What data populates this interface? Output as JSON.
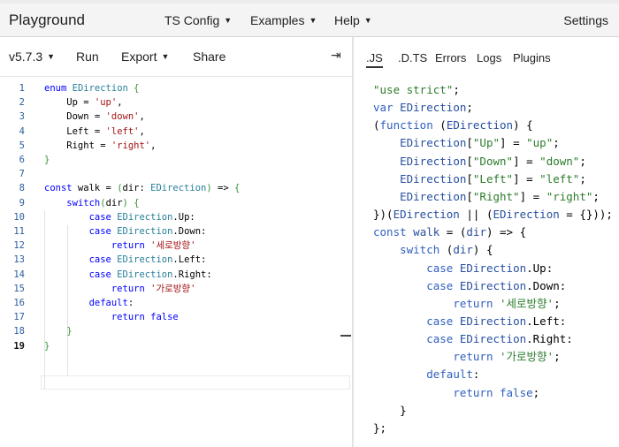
{
  "app": {
    "brand": "Playground",
    "menus": [
      {
        "label": "TS Config"
      },
      {
        "label": "Examples"
      },
      {
        "label": "Help"
      }
    ],
    "settings_label": "Settings"
  },
  "toolbar": {
    "version": "v5.7.3",
    "run": "Run",
    "export": "Export",
    "share": "Share",
    "collapse_icon": "arrow-right-to-bar-icon"
  },
  "output_tabs": [
    ".JS",
    ".D.TS",
    "Errors",
    "Logs",
    "Plugins"
  ],
  "output_active_tab": ".JS",
  "editor": {
    "active_line": 19,
    "lines": [
      {
        "n": "1",
        "text": "enum EDirection {"
      },
      {
        "n": "2",
        "text": "    Up = 'up',"
      },
      {
        "n": "3",
        "text": "    Down = 'down',"
      },
      {
        "n": "4",
        "text": "    Left = 'left',"
      },
      {
        "n": "5",
        "text": "    Right = 'right',"
      },
      {
        "n": "6",
        "text": "}"
      },
      {
        "n": "7",
        "text": ""
      },
      {
        "n": "8",
        "text": "const walk = (dir: EDirection) => {"
      },
      {
        "n": "9",
        "text": "    switch(dir) {"
      },
      {
        "n": "10",
        "text": "        case EDirection.Up:"
      },
      {
        "n": "11",
        "text": "        case EDirection.Down:"
      },
      {
        "n": "12",
        "text": "            return '세로방향'"
      },
      {
        "n": "13",
        "text": "        case EDirection.Left:"
      },
      {
        "n": "14",
        "text": "        case EDirection.Right:"
      },
      {
        "n": "15",
        "text": "            return '가로방향'"
      },
      {
        "n": "16",
        "text": "        default:"
      },
      {
        "n": "17",
        "text": "            return false"
      },
      {
        "n": "18",
        "text": "    }"
      },
      {
        "n": "19",
        "text": "}"
      }
    ]
  },
  "output": {
    "lines": [
      "\"use strict\";",
      "var EDirection;",
      "(function (EDirection) {",
      "    EDirection[\"Up\"] = \"up\";",
      "    EDirection[\"Down\"] = \"down\";",
      "    EDirection[\"Left\"] = \"left\";",
      "    EDirection[\"Right\"] = \"right\";",
      "})(EDirection || (EDirection = {}));",
      "const walk = (dir) => {",
      "    switch (dir) {",
      "        case EDirection.Up:",
      "        case EDirection.Down:",
      "            return '세로방향';",
      "        case EDirection.Left:",
      "        case EDirection.Right:",
      "            return '가로방향';",
      "        default:",
      "            return false;",
      "    }",
      "};"
    ]
  }
}
